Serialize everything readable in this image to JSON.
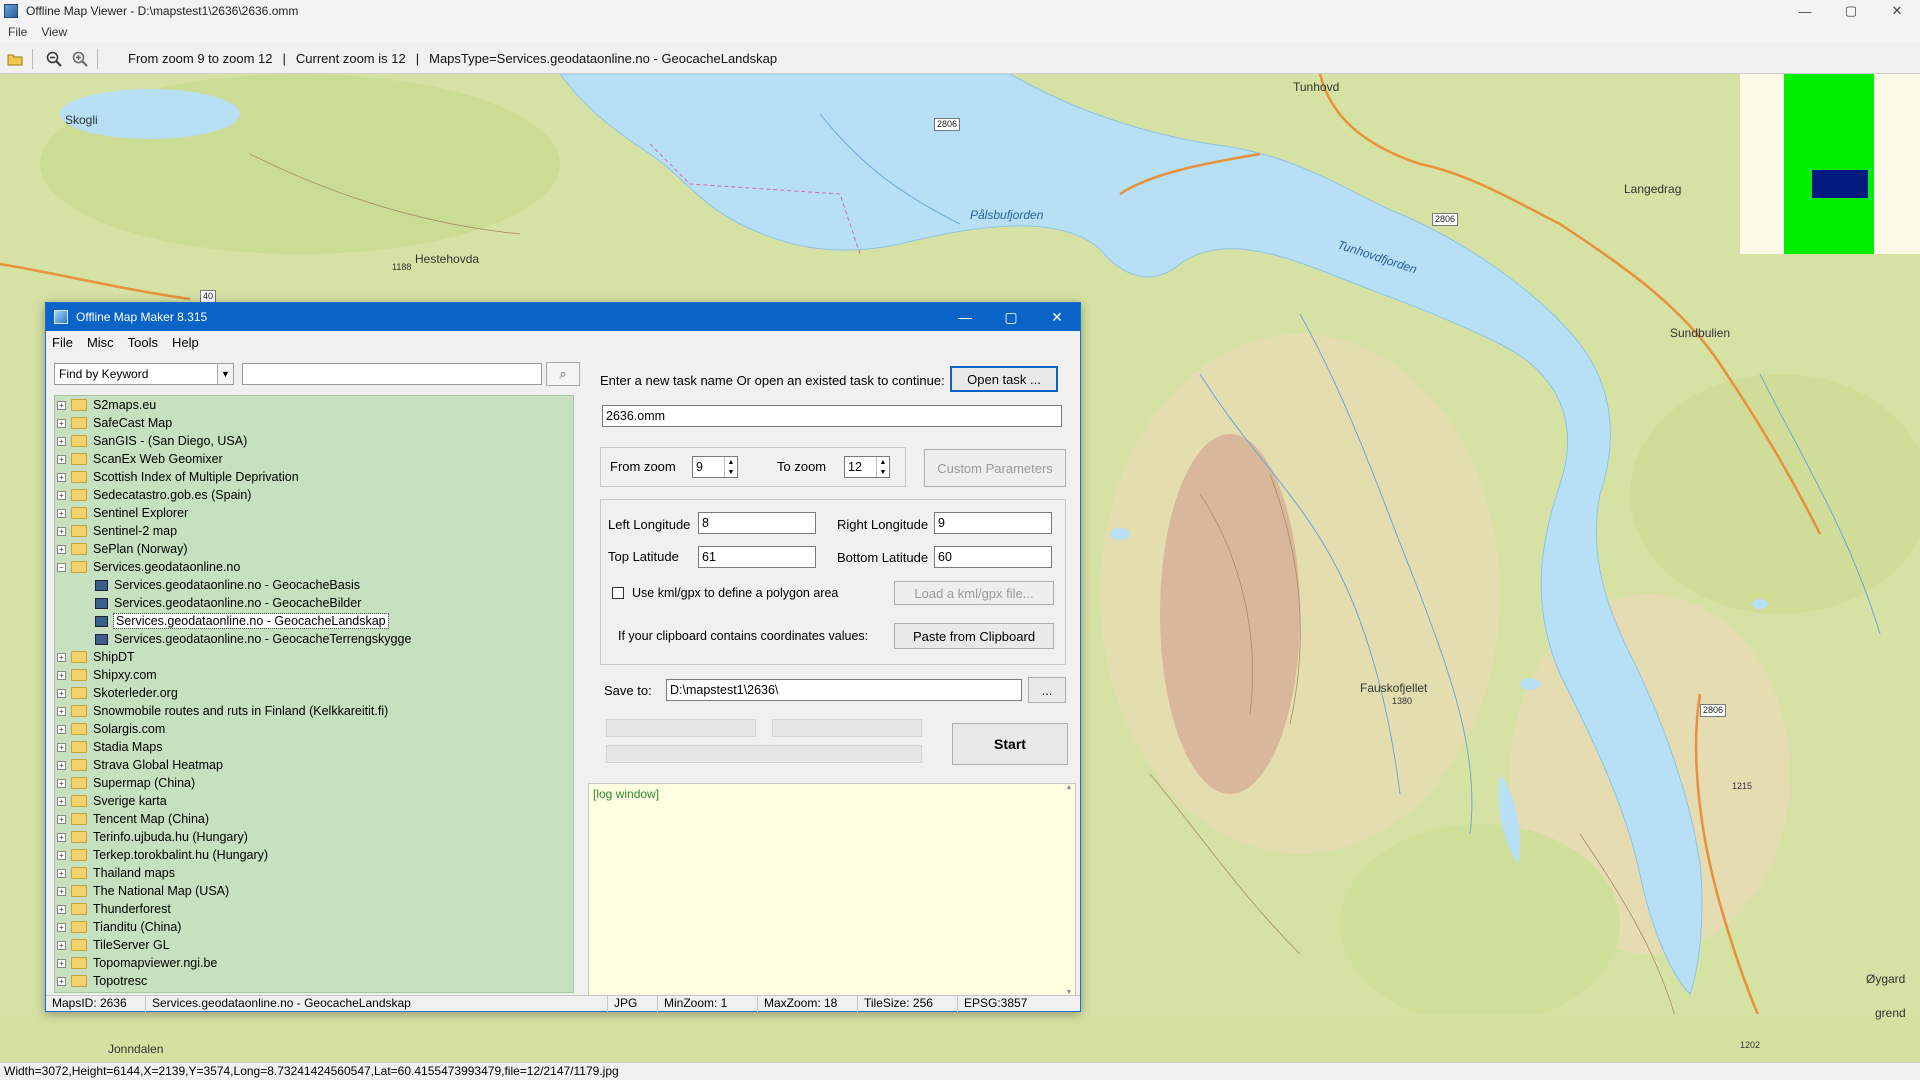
{
  "window": {
    "title": "Offline Map Viewer - D:\\mapstest1\\2636\\2636.omm",
    "controls": {
      "minimize": "—",
      "maximize": "▢",
      "close": "✕"
    }
  },
  "menu": {
    "file": "File",
    "view": "View"
  },
  "toolbar": {
    "zoom_range": "From zoom 9 to zoom 12",
    "current_zoom": "Current zoom is 12",
    "maps_type": "MapsType=Services.geodataonline.no - GeocacheLandskap",
    "icons": [
      "folder-open-icon",
      "zoom-out-icon",
      "zoom-in-icon"
    ]
  },
  "map": {
    "labels": {
      "skogli": "Skogli",
      "hestehovda": "Hestehovda",
      "h1188": "1188",
      "palsbufjorden": "Pålsbufjorden",
      "tunhovd": "Tunhovd",
      "langedrag": "Langedrag",
      "tunhovdfjorden": "Tunhovdfjorden",
      "sundbulien": "Sundbulien",
      "fauskofjellet": "Fauskofjellet",
      "h1380": "1380",
      "h1215": "1215",
      "oygard": "Øygard",
      "grend": "grend",
      "jonndalen": "Jonndalen",
      "h1202": "1202"
    },
    "roads": {
      "r2806a": "2806",
      "r2806b": "2806",
      "r2806c": "2806",
      "r40": "40",
      "r2806d": "2806"
    }
  },
  "statusbar": {
    "text": "Width=3072,Height=6144,X=2139,Y=3574,Long=8.73241424560547,Lat=60.4155473993479,file=12/2147/1179.jpg"
  },
  "dialog": {
    "title": "Offline Map Maker 8.315",
    "menu": {
      "file": "File",
      "misc": "Misc",
      "tools": "Tools",
      "help": "Help"
    },
    "search": {
      "mode": "Find by Keyword",
      "value": "",
      "button": "⌕"
    },
    "tree": [
      {
        "label": "S2maps.eu",
        "type": "folder"
      },
      {
        "label": "SafeCast Map",
        "type": "folder"
      },
      {
        "label": "SanGIS - (San Diego, USA)",
        "type": "folder"
      },
      {
        "label": "ScanEx Web Geomixer",
        "type": "folder"
      },
      {
        "label": "Scottish Index of Multiple Deprivation",
        "type": "folder"
      },
      {
        "label": "Sedecatastro.gob.es (Spain)",
        "type": "folder"
      },
      {
        "label": "Sentinel Explorer",
        "type": "folder"
      },
      {
        "label": "Sentinel-2 map",
        "type": "folder"
      },
      {
        "label": "SePlan (Norway)",
        "type": "folder"
      },
      {
        "label": "Services.geodataonline.no",
        "type": "folder-open"
      },
      {
        "label": "Services.geodataonline.no - GeocacheBasis",
        "type": "child"
      },
      {
        "label": "Services.geodataonline.no - GeocacheBilder",
        "type": "child"
      },
      {
        "label": "Services.geodataonline.no - GeocacheLandskap",
        "type": "child-selected"
      },
      {
        "label": "Services.geodataonline.no - GeocacheTerrengskygge",
        "type": "child"
      },
      {
        "label": "ShipDT",
        "type": "folder"
      },
      {
        "label": "Shipxy.com",
        "type": "folder"
      },
      {
        "label": "Skoterleder.org",
        "type": "folder"
      },
      {
        "label": "Snowmobile routes and ruts in Finland (Kelkkareitit.fi)",
        "type": "folder"
      },
      {
        "label": "Solargis.com",
        "type": "folder"
      },
      {
        "label": "Stadia Maps",
        "type": "folder"
      },
      {
        "label": "Strava Global Heatmap",
        "type": "folder"
      },
      {
        "label": "Supermap (China)",
        "type": "folder"
      },
      {
        "label": "Sverige karta",
        "type": "folder"
      },
      {
        "label": "Tencent Map (China)",
        "type": "folder"
      },
      {
        "label": "Terinfo.ujbuda.hu (Hungary)",
        "type": "folder"
      },
      {
        "label": "Terkep.torokbalint.hu (Hungary)",
        "type": "folder"
      },
      {
        "label": "Thailand maps",
        "type": "folder"
      },
      {
        "label": "The National Map (USA)",
        "type": "folder"
      },
      {
        "label": "Thunderforest",
        "type": "folder"
      },
      {
        "label": "Tianditu (China)",
        "type": "folder"
      },
      {
        "label": "TileServer GL",
        "type": "folder"
      },
      {
        "label": "Topomapviewer.ngi.be",
        "type": "folder"
      },
      {
        "label": "Topotresc",
        "type": "folder"
      }
    ],
    "task": {
      "prompt": "Enter a new task name Or open an existed task to continue:",
      "open_button": "Open task ...",
      "name": "2636.omm"
    },
    "zoom": {
      "from_label": "From zoom",
      "from_value": "9",
      "to_label": "To zoom",
      "to_value": "12",
      "custom_button": "Custom Parameters"
    },
    "coords": {
      "left_lon_label": "Left Longitude",
      "left_lon": "8",
      "right_lon_label": "Right Longitude",
      "right_lon": "9",
      "top_lat_label": "Top Latitude",
      "top_lat": "61",
      "bottom_lat_label": "Bottom Latitude",
      "bottom_lat": "60",
      "kml_label": "Use kml/gpx to define a polygon area",
      "kml_checked": false,
      "kml_button": "Load a kml/gpx file...",
      "clipboard_label": "If your clipboard contains coordinates values:",
      "clipboard_button": "Paste from Clipboard"
    },
    "save": {
      "label": "Save to:",
      "path": "D:\\mapstest1\\2636\\",
      "browse": "..."
    },
    "start_button": "Start",
    "progress": [
      0,
      0,
      0
    ],
    "log": "[log window]",
    "status": {
      "maps_id": "MapsID: 2636",
      "maps_name": "Services.geodataonline.no - GeocacheLandskap",
      "format": "JPG",
      "min_zoom": "MinZoom: 1",
      "max_zoom": "MaxZoom: 18",
      "tile_size": "TileSize: 256",
      "epsg": "EPSG:3857"
    }
  },
  "colors": {
    "map_land": "#d8e3a8",
    "map_water": "#b7dff5",
    "tree_bg": "#c7e0c0",
    "dialog_title": "#0a64c8",
    "log_bg": "#fffee0",
    "minimap_green": "#00ee00",
    "minimap_blue": "#001a80"
  }
}
